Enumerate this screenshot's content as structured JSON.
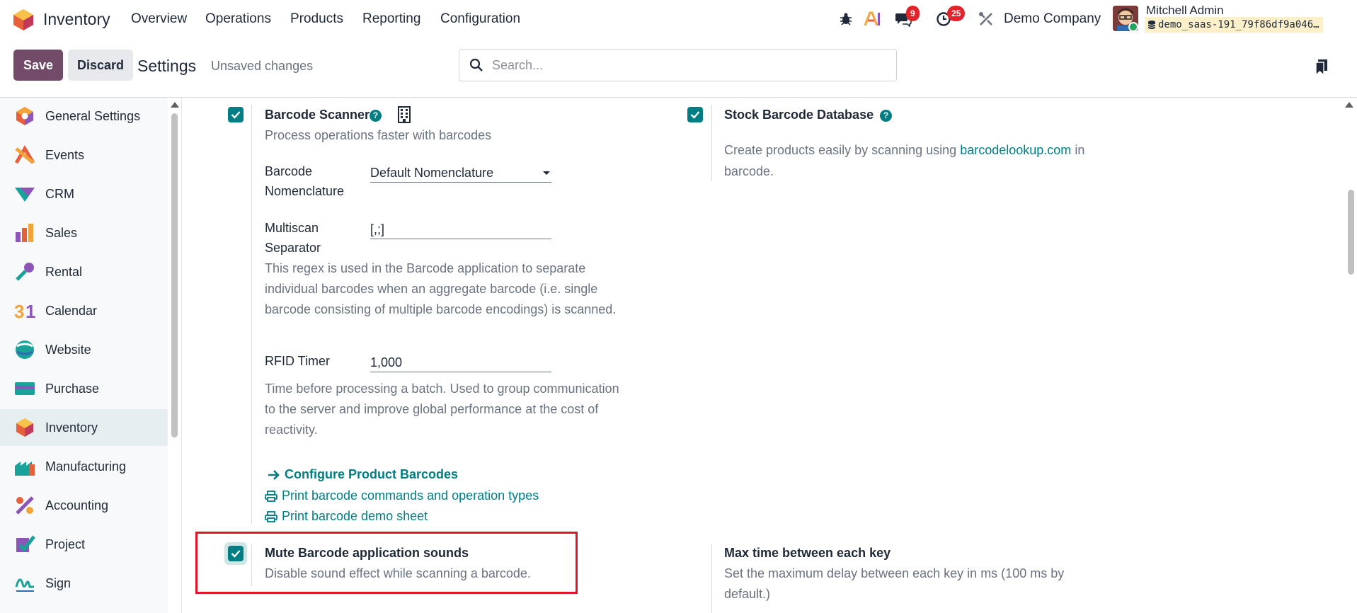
{
  "navbar": {
    "app_name": "Inventory",
    "menu": [
      "Overview",
      "Operations",
      "Products",
      "Reporting",
      "Configuration"
    ],
    "messages_badge": "9",
    "activities_badge": "25",
    "company": "Demo Company",
    "user_name": "Mitchell Admin",
    "database": "demo_saas-191_79f86df9a046…"
  },
  "control": {
    "save_label": "Save",
    "discard_label": "Discard",
    "title": "Settings",
    "status": "Unsaved changes",
    "search_placeholder": "Search..."
  },
  "sidebar": {
    "items": [
      {
        "label": "General Settings",
        "icon": "general-settings-icon"
      },
      {
        "label": "Events",
        "icon": "events-icon"
      },
      {
        "label": "CRM",
        "icon": "crm-icon"
      },
      {
        "label": "Sales",
        "icon": "sales-icon"
      },
      {
        "label": "Rental",
        "icon": "rental-icon"
      },
      {
        "label": "Calendar",
        "icon": "calendar-icon"
      },
      {
        "label": "Website",
        "icon": "website-icon"
      },
      {
        "label": "Purchase",
        "icon": "purchase-icon"
      },
      {
        "label": "Inventory",
        "icon": "inventory-icon",
        "active": true
      },
      {
        "label": "Manufacturing",
        "icon": "manufacturing-icon"
      },
      {
        "label": "Accounting",
        "icon": "accounting-icon"
      },
      {
        "label": "Project",
        "icon": "project-icon"
      },
      {
        "label": "Sign",
        "icon": "sign-icon"
      }
    ]
  },
  "settings": {
    "barcode_scanner": {
      "title": "Barcode Scanner",
      "checked": true,
      "description": "Process operations faster with barcodes",
      "nomenclature_label_1": "Barcode",
      "nomenclature_label_2": "Nomenclature",
      "nomenclature_value": "Default Nomenclature",
      "multiscan_label_1": "Multiscan",
      "multiscan_label_2": "Separator",
      "multiscan_value": "[,;]",
      "multiscan_help_1": "This regex is used in the Barcode application to separate",
      "multiscan_help_2": "individual barcodes when an aggregate barcode (i.e. single",
      "multiscan_help_3": "barcode consisting of multiple barcode encodings) is scanned.",
      "rfid_label": "RFID Timer",
      "rfid_value": "1,000",
      "rfid_help_1": "Time before processing a batch. Used to group communication",
      "rfid_help_2": "to the server and improve global performance at the cost of",
      "rfid_help_3": "reactivity.",
      "link_configure": "Configure Product Barcodes",
      "link_print_commands": "Print barcode commands and operation types",
      "link_print_demo": "Print barcode demo sheet"
    },
    "stock_barcode_db": {
      "title": "Stock Barcode Database",
      "checked": true,
      "desc_prefix": "Create products easily by scanning using",
      "desc_link": "barcodelookup.com",
      "desc_suffix": "in",
      "desc_line2": "barcode."
    },
    "mute_sounds": {
      "title": "Mute Barcode application sounds",
      "checked": true,
      "description": "Disable sound effect while scanning a barcode."
    },
    "max_time": {
      "title": "Max time between each key",
      "desc_1": "Set the maximum delay between each key in ms (100 ms by",
      "desc_2": "default.)"
    }
  },
  "colors": {
    "brand": "#714b67",
    "accent": "#017e84",
    "highlight": "#e0152b"
  }
}
